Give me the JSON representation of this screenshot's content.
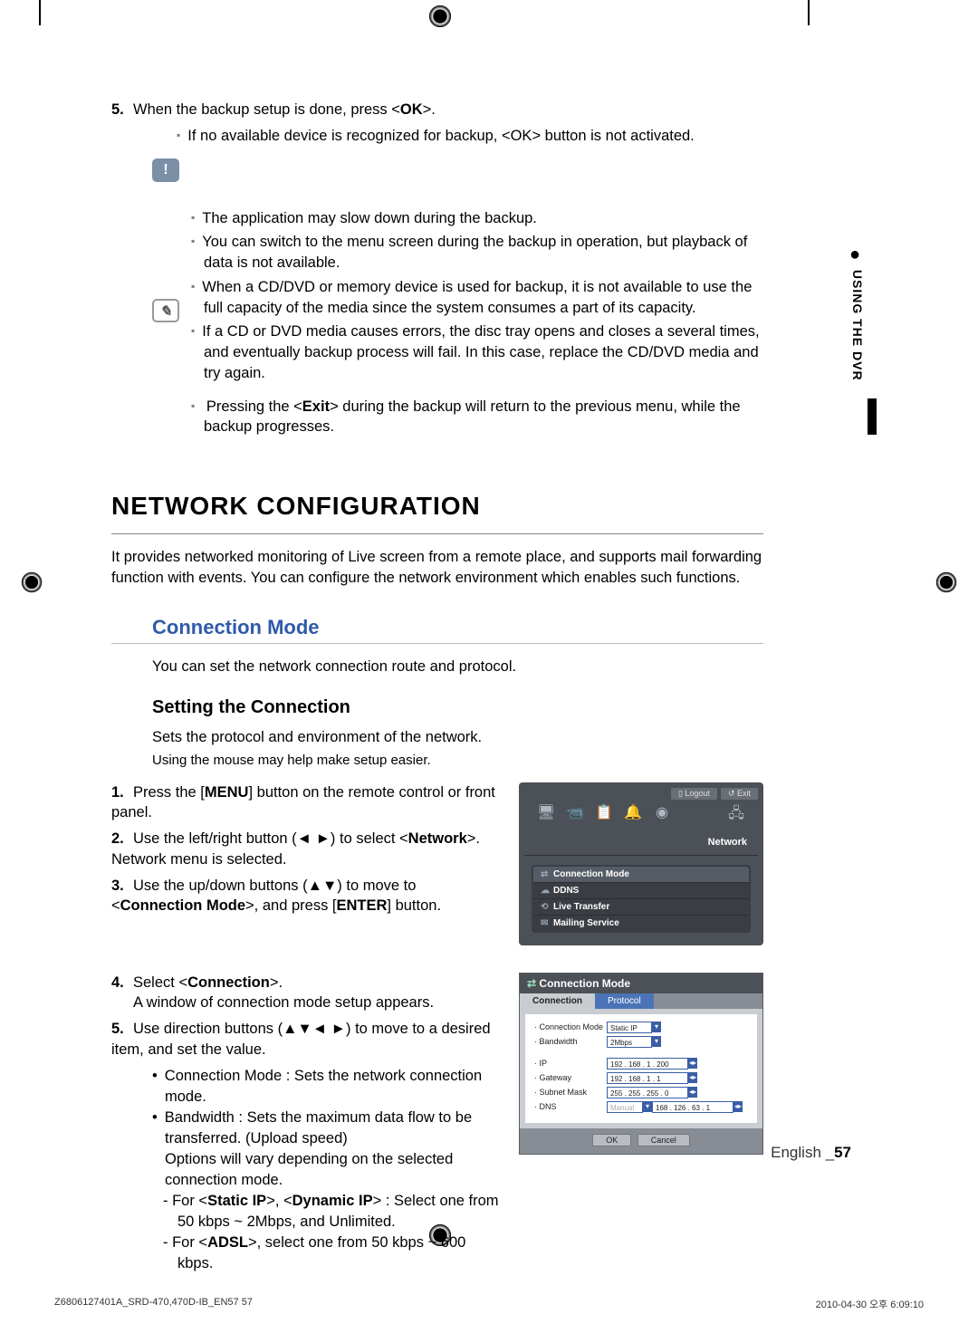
{
  "side_tab": "USING THE DVR",
  "step5": {
    "num": "5.",
    "text_a": "When the backup setup is done, press <",
    "text_b": "OK",
    "text_c": ">."
  },
  "step5_sub": "If no available device is recognized for backup, <OK> button is not activated.",
  "warn": [
    "The application may slow down during the backup.",
    "You can switch to the menu screen during the backup in operation, but playback of data is not available.",
    "When a CD/DVD or memory device is used for backup, it is not available to use the full capacity of the media since the system consumes a part of its capacity.",
    "If a CD or DVD media causes errors, the disc tray opens and closes a several times, and eventually backup process will fail. In this case, replace the CD/DVD media and try again."
  ],
  "note_a": "Pressing the <",
  "note_b": "Exit",
  "note_c": "> during the backup will return to the previous menu, while the backup progresses.",
  "h1": "NETWORK CONFIGURATION",
  "lead": "It provides networked monitoring of Live screen from a remote place, and supports mail forwarding function with events. You can configure the network environment which enables such functions.",
  "h2": "Connection Mode",
  "h2_body": "You can set the network connection route and protocol.",
  "h3": "Setting the Connection",
  "h3_body1": "Sets the protocol and environment of the network.",
  "h3_body2": "Using the mouse may help make setup easier.",
  "steps": {
    "s1": {
      "n": "1.",
      "a": "Press the [",
      "b": "MENU",
      "c": "] button on the remote control or front panel."
    },
    "s2": {
      "n": "2.",
      "a": "Use the left/right button (◄ ►) to select <",
      "b": "Network",
      "c": ">. Network menu is selected."
    },
    "s3": {
      "n": "3.",
      "a": "Use the up/down buttons (▲▼) to move to <",
      "b": "Connection Mode",
      "c": ">, and press [",
      "d": "ENTER",
      "e": "] button."
    },
    "s4": {
      "n": "4.",
      "a": "Select <",
      "b": "Connection",
      "c": ">.",
      "d": "A window of connection mode setup appears."
    },
    "s5": {
      "n": "5.",
      "a": "Use direction buttons (▲▼◄ ►) to move to a desired item, and set the value."
    }
  },
  "bul1": "Connection Mode : Sets the network connection mode.",
  "bul2": "Bandwidth : Sets the maximum data flow to be transferred. (Upload speed)",
  "bul2b": "Options will vary depending on the selected connection mode.",
  "dash1_a": "For <",
  "dash1_b": "Static IP",
  "dash1_c": ">, <",
  "dash1_d": "Dynamic IP",
  "dash1_e": "> : Select one from 50 kbps ~ 2Mbps, and Unlimited.",
  "dash2_a": "For <",
  "dash2_b": "ADSL",
  "dash2_c": ">, select one from 50 kbps ~ 600 kbps.",
  "ui1": {
    "logout": "Logout",
    "exit": "Exit",
    "network": "Network",
    "m1": "Connection Mode",
    "m2": "DDNS",
    "m3": "Live Transfer",
    "m4": "Mailing Service"
  },
  "ui2": {
    "title": "Connection Mode",
    "tab1": "Connection",
    "tab2": "Protocol",
    "r_mode_l": "· Connection Mode",
    "r_mode_v": "Static IP",
    "r_bw_l": "· Bandwidth",
    "r_bw_v": "2Mbps",
    "r_ip_l": "· IP",
    "r_ip_v": "192 . 168 .   1 . 200",
    "r_gw_l": "· Gateway",
    "r_gw_v": "192 . 168 .   1 .    1",
    "r_sm_l": "· Subnet Mask",
    "r_sm_v": "255 . 255 . 255 .    0",
    "r_dns_l": "· DNS",
    "r_dns_sel": "Manual",
    "r_dns_v": "168 . 126 .  63 .    1",
    "ok": "OK",
    "cancel": "Cancel"
  },
  "footer_lang": "English _",
  "footer_page": "57",
  "meta_left": "Z6806127401A_SRD-470,470D-IB_EN57   57",
  "meta_right": "2010-04-30   오후 6:09:10"
}
